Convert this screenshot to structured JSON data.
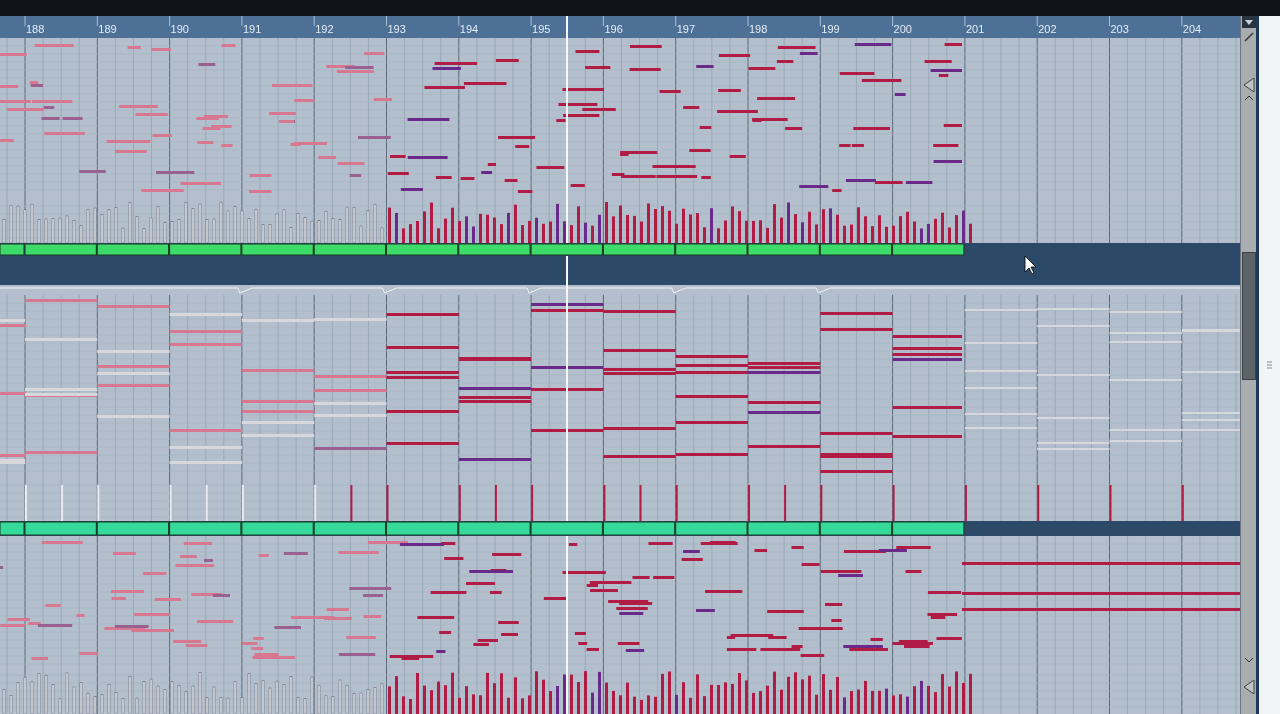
{
  "ruler": {
    "bars": [
      "188",
      "189",
      "190",
      "191",
      "192",
      "193",
      "194",
      "195",
      "196",
      "197",
      "198",
      "199",
      "200",
      "201",
      "202",
      "203",
      "204"
    ]
  },
  "part_lanes": [
    {
      "color": "#3ddc6a"
    },
    {
      "color": "#35d99a"
    }
  ]
}
